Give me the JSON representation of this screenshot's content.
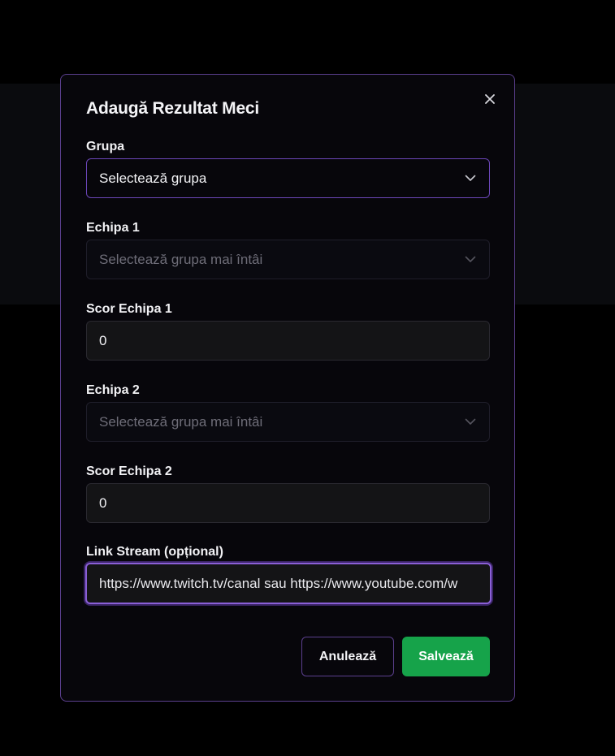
{
  "modal": {
    "title": "Adaugă Rezultat Meci",
    "close_icon": "close-icon"
  },
  "form": {
    "group": {
      "label": "Grupa",
      "selected": "Selectează grupa"
    },
    "team1": {
      "label": "Echipa 1",
      "selected": "Selectează grupa mai întâi"
    },
    "score1": {
      "label": "Scor Echipa 1",
      "value": "0"
    },
    "team2": {
      "label": "Echipa 2",
      "selected": "Selectează grupa mai întâi"
    },
    "score2": {
      "label": "Scor Echipa 2",
      "value": "0"
    },
    "stream": {
      "label": "Link Stream (opțional)",
      "placeholder": "https://www.twitch.tv/canal sau https://www.youtube.com/w"
    }
  },
  "actions": {
    "cancel_label": "Anulează",
    "save_label": "Salvează"
  },
  "colors": {
    "accent": "#8a5fd6",
    "save": "#16a34a"
  }
}
